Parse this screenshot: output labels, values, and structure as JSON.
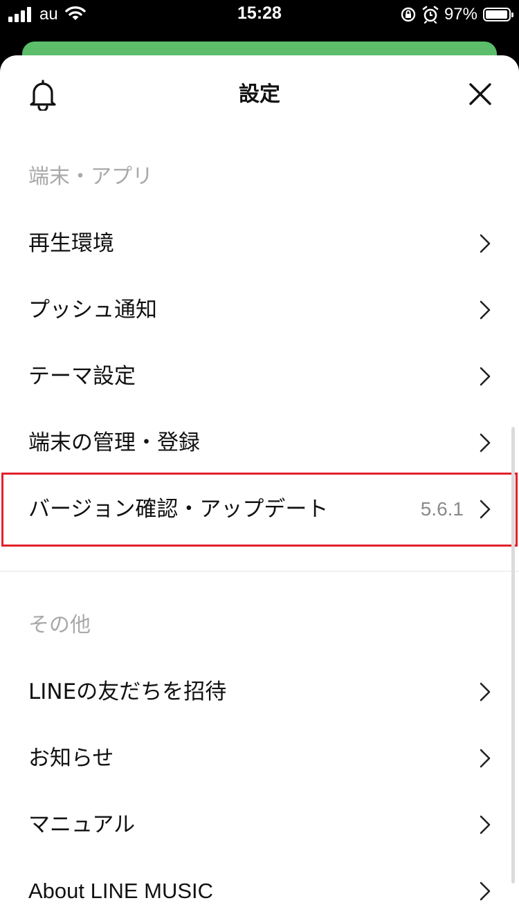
{
  "status_bar": {
    "carrier": "au",
    "time": "15:28",
    "battery_percent": "97%",
    "battery_level": 0.97,
    "icons": [
      "signal-icon",
      "wifi-icon",
      "orientation-lock-icon",
      "alarm-icon",
      "battery-icon"
    ]
  },
  "colors": {
    "accent_green": "#5cbd6a",
    "highlight_red": "#e3202c",
    "section_label": "#a9a9a9",
    "value_gray": "#8a8a8a"
  },
  "header": {
    "title": "設定",
    "left_icon": "bell-icon",
    "right_icon": "close-icon"
  },
  "sections": [
    {
      "label": "端末・アプリ",
      "items": [
        {
          "label": "再生環境",
          "value": ""
        },
        {
          "label": "プッシュ通知",
          "value": ""
        },
        {
          "label": "テーマ設定",
          "value": ""
        },
        {
          "label": "端末の管理・登録",
          "value": ""
        },
        {
          "label": "バージョン確認・アップデート",
          "value": "5.6.1"
        }
      ]
    },
    {
      "label": "その他",
      "items": [
        {
          "label": "LINEの友だちを招待",
          "value": ""
        },
        {
          "label": "お知らせ",
          "value": ""
        },
        {
          "label": "マニュアル",
          "value": ""
        },
        {
          "label": "About LINE MUSIC",
          "value": ""
        }
      ]
    }
  ]
}
